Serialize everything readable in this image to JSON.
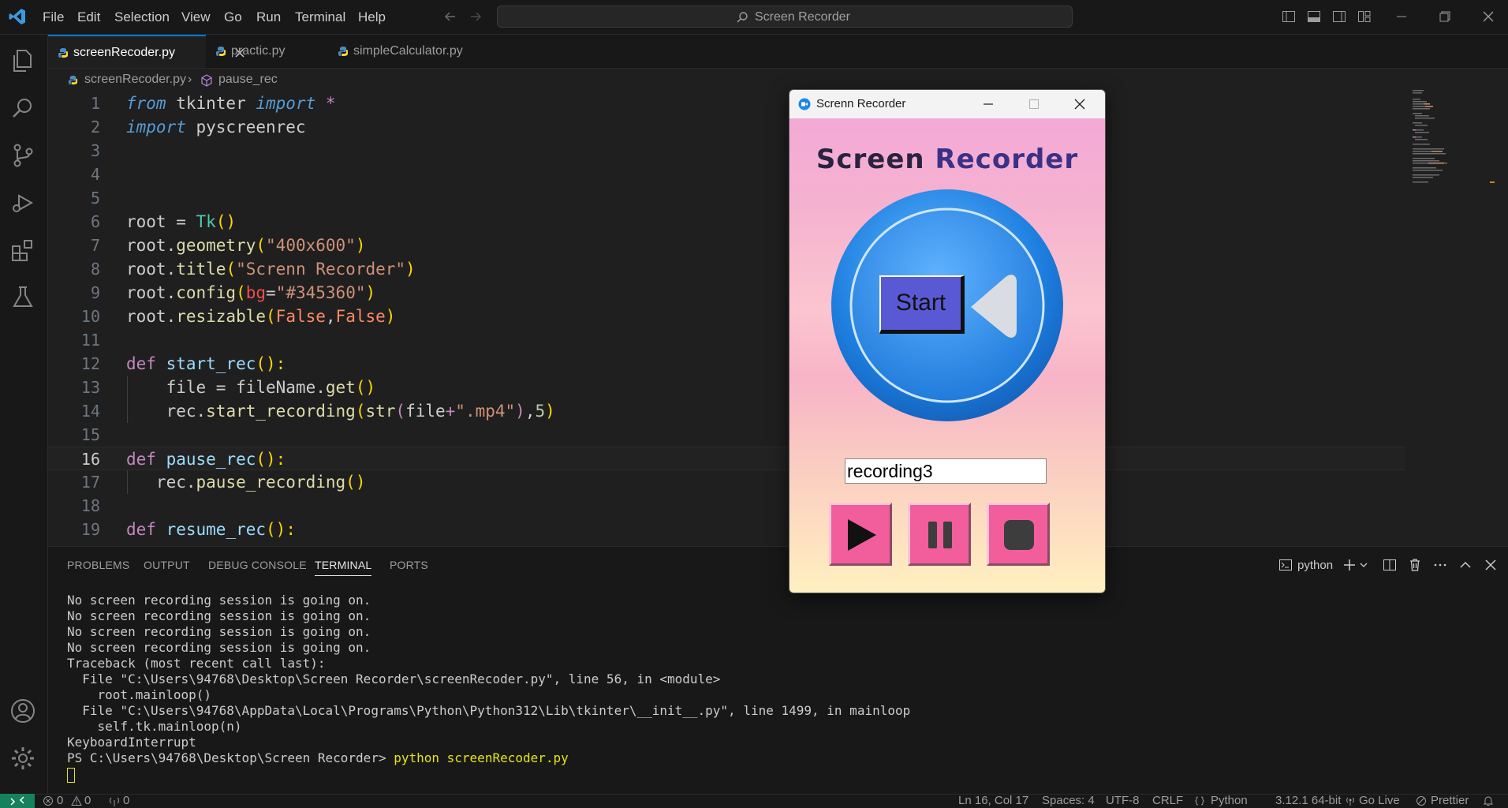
{
  "menu": [
    "File",
    "Edit",
    "Selection",
    "View",
    "Go",
    "Run",
    "Terminal",
    "Help"
  ],
  "command_center": {
    "label": "Screen Recorder"
  },
  "tabs": [
    {
      "label": "screenRecoder.py"
    },
    {
      "label": "practic.py"
    },
    {
      "label": "simpleCalculator.py"
    }
  ],
  "breadcrumb": {
    "file": "screenRecoder.py",
    "symbol": "pause_rec"
  },
  "code_lines": [
    {
      "n": "1"
    },
    {
      "n": "2"
    },
    {
      "n": "3"
    },
    {
      "n": "4"
    },
    {
      "n": "5"
    },
    {
      "n": "6"
    },
    {
      "n": "7"
    },
    {
      "n": "8"
    },
    {
      "n": "9"
    },
    {
      "n": "10"
    },
    {
      "n": "11"
    },
    {
      "n": "12"
    },
    {
      "n": "13"
    },
    {
      "n": "14"
    },
    {
      "n": "15"
    },
    {
      "n": "16"
    },
    {
      "n": "17"
    },
    {
      "n": "18"
    },
    {
      "n": "19"
    }
  ],
  "code": {
    "l1": [
      "from",
      " tkinter ",
      "import",
      " *"
    ],
    "l2": [
      "import",
      " pyscreenrec"
    ],
    "l6": [
      "root = ",
      "Tk",
      "()"
    ],
    "l7": [
      "root.",
      "geometry",
      "(",
      "\"400x600\"",
      ")"
    ],
    "l8": [
      "root.",
      "title",
      "(",
      "\"Screnn Recorder\"",
      ")"
    ],
    "l9": [
      "root.",
      "config",
      "(",
      "bg",
      "=",
      "\"#345360\"",
      ")"
    ],
    "l10": [
      "root.",
      "resizable",
      "(",
      "False",
      ",",
      "False",
      ")"
    ],
    "l12": [
      "def",
      " ",
      "start_rec",
      "():"
    ],
    "l13": [
      "    file = fileName.",
      "get",
      "()"
    ],
    "l14": [
      "    rec.",
      "start_recording",
      "(",
      "str",
      "(",
      "file",
      "+",
      "\".mp4\"",
      ")",
      ",",
      "5",
      ")"
    ],
    "l16": [
      "def",
      " ",
      "pause_rec",
      "():"
    ],
    "l17": [
      "   rec.",
      "pause_recording",
      "()"
    ],
    "l19": [
      "def",
      " ",
      "resume_rec",
      "():"
    ]
  },
  "panel": {
    "tabs": [
      "PROBLEMS",
      "OUTPUT",
      "DEBUG CONSOLE",
      "TERMINAL",
      "PORTS"
    ],
    "active_tab": "TERMINAL",
    "terminal_name": "python",
    "terminal_lines": [
      "No screen recording session is going on.",
      "No screen recording session is going on.",
      "No screen recording session is going on.",
      "No screen recording session is going on.",
      "Traceback (most recent call last):",
      "  File \"C:\\Users\\94768\\Desktop\\Screen Recorder\\screenRecoder.py\", line 56, in <module>",
      "    root.mainloop()",
      "  File \"C:\\Users\\94768\\AppData\\Local\\Programs\\Python\\Python312\\Lib\\tkinter\\__init__.py\", line 1499, in mainloop",
      "    self.tk.mainloop(n)",
      "KeyboardInterrupt"
    ],
    "prompt": "PS C:\\Users\\94768\\Desktop\\Screen Recorder> ",
    "command": "python screenRecoder.py"
  },
  "status": {
    "errors": "0",
    "warnings": "0",
    "ports": "0",
    "position": "Ln 16, Col 17",
    "spaces": "Spaces: 4",
    "encoding": "UTF-8",
    "eol": "CRLF",
    "language": "Python",
    "interpreter": "3.12.1 64-bit",
    "golive": "Go Live",
    "prettier": "Prettier"
  },
  "tk_window": {
    "title": "Screnn Recorder",
    "heading_part1": "Screen",
    "heading_part2": "Recorder",
    "start_label": "Start",
    "filename_value": "recording3"
  },
  "colors": {
    "accent": "#0078d4",
    "app_bg_pink": "#f5b3cf",
    "control_pink": "#f25d9c",
    "start_blue": "#5a59d4"
  }
}
